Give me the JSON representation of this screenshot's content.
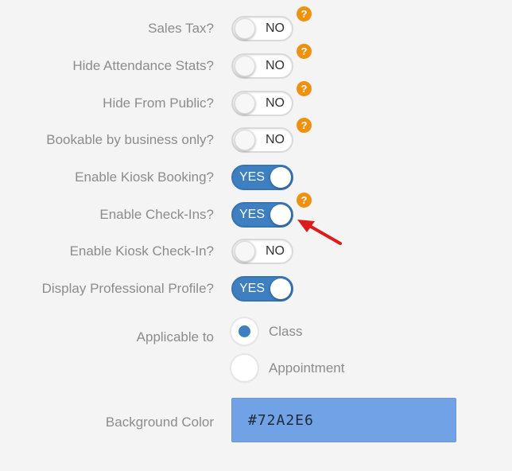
{
  "help_glyph": "?",
  "toggles": [
    {
      "label": "Sales Tax?",
      "state": "NO",
      "help": true
    },
    {
      "label": "Hide Attendance Stats?",
      "state": "NO",
      "help": true
    },
    {
      "label": "Hide From Public?",
      "state": "NO",
      "help": true
    },
    {
      "label": "Bookable by business only?",
      "state": "NO",
      "help": true
    },
    {
      "label": "Enable Kiosk Booking?",
      "state": "YES",
      "help": false
    },
    {
      "label": "Enable Check-Ins?",
      "state": "YES",
      "help": true
    },
    {
      "label": "Enable Kiosk Check-In?",
      "state": "NO",
      "help": false
    },
    {
      "label": "Display Professional Profile?",
      "state": "YES",
      "help": false
    }
  ],
  "applicable_to": {
    "label": "Applicable to",
    "options": [
      {
        "label": "Class",
        "selected": true
      },
      {
        "label": "Appointment",
        "selected": false
      }
    ]
  },
  "background_color": {
    "label": "Background Color",
    "value": "#72A2E6"
  },
  "colors": {
    "toggle_on": "#3d7fc1",
    "help_badge": "#f0910e",
    "annotation_arrow": "#e01b1b"
  }
}
